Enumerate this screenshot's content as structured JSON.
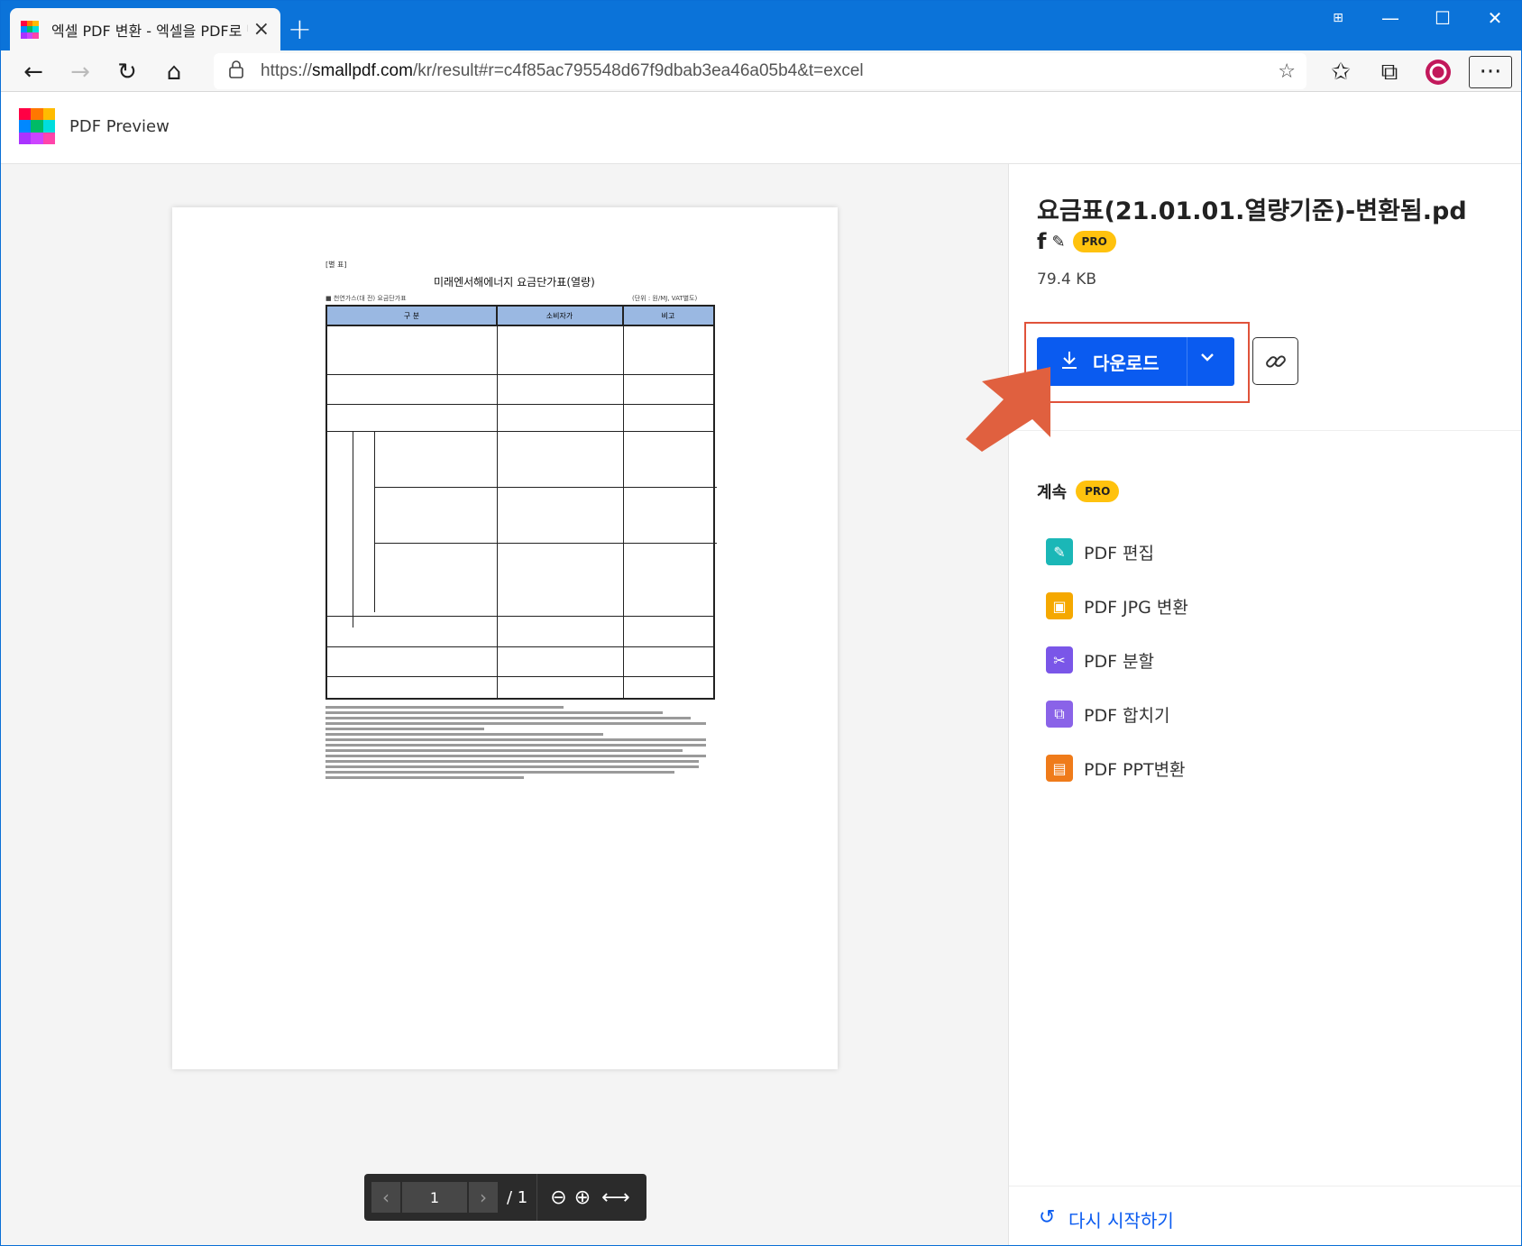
{
  "browser": {
    "tab_title": "엑셀 PDF 변환 - 엑셀을 PDF로 변",
    "url_prefix": "https://",
    "url_host": "smallpdf.com",
    "url_path": "/kr/result#r=c4f85ac795548d67f9dbab3ea46a05b4&t=excel"
  },
  "app": {
    "title": "PDF Preview"
  },
  "document": {
    "tag": "[별 표]",
    "heading": "미래엔서해에너지 요금단가표(열량)",
    "sub": "■ 천연가스(대 전) 요금단가표",
    "unit": "(단위 : 원/MJ, VAT별도)",
    "col1": "구 분",
    "col2": "소비자가",
    "col3": "비고"
  },
  "pager": {
    "page": "1",
    "total": "/ 1"
  },
  "file": {
    "name": "요금표(21.01.01.열량기준)-변환됨.pd",
    "name_tail": "f",
    "pro": "PRO",
    "size": "79.4 KB"
  },
  "download": {
    "label": "다운로드"
  },
  "continue": {
    "title": "계속",
    "pro": "PRO",
    "tools": [
      {
        "label": "PDF 편집",
        "color": "#1bb7b7"
      },
      {
        "label": "PDF JPG 변환",
        "color": "#f5a800"
      },
      {
        "label": "PDF 분할",
        "color": "#7a56e8"
      },
      {
        "label": "PDF 합치기",
        "color": "#8a63e8"
      },
      {
        "label": "PDF PPT변환",
        "color": "#ef7b1a"
      }
    ]
  },
  "restart": {
    "label": "다시 시작하기"
  },
  "colors": {
    "accent": "#0a5bf0",
    "highlight": "#e0523a",
    "chrome": "#0b73d9"
  }
}
